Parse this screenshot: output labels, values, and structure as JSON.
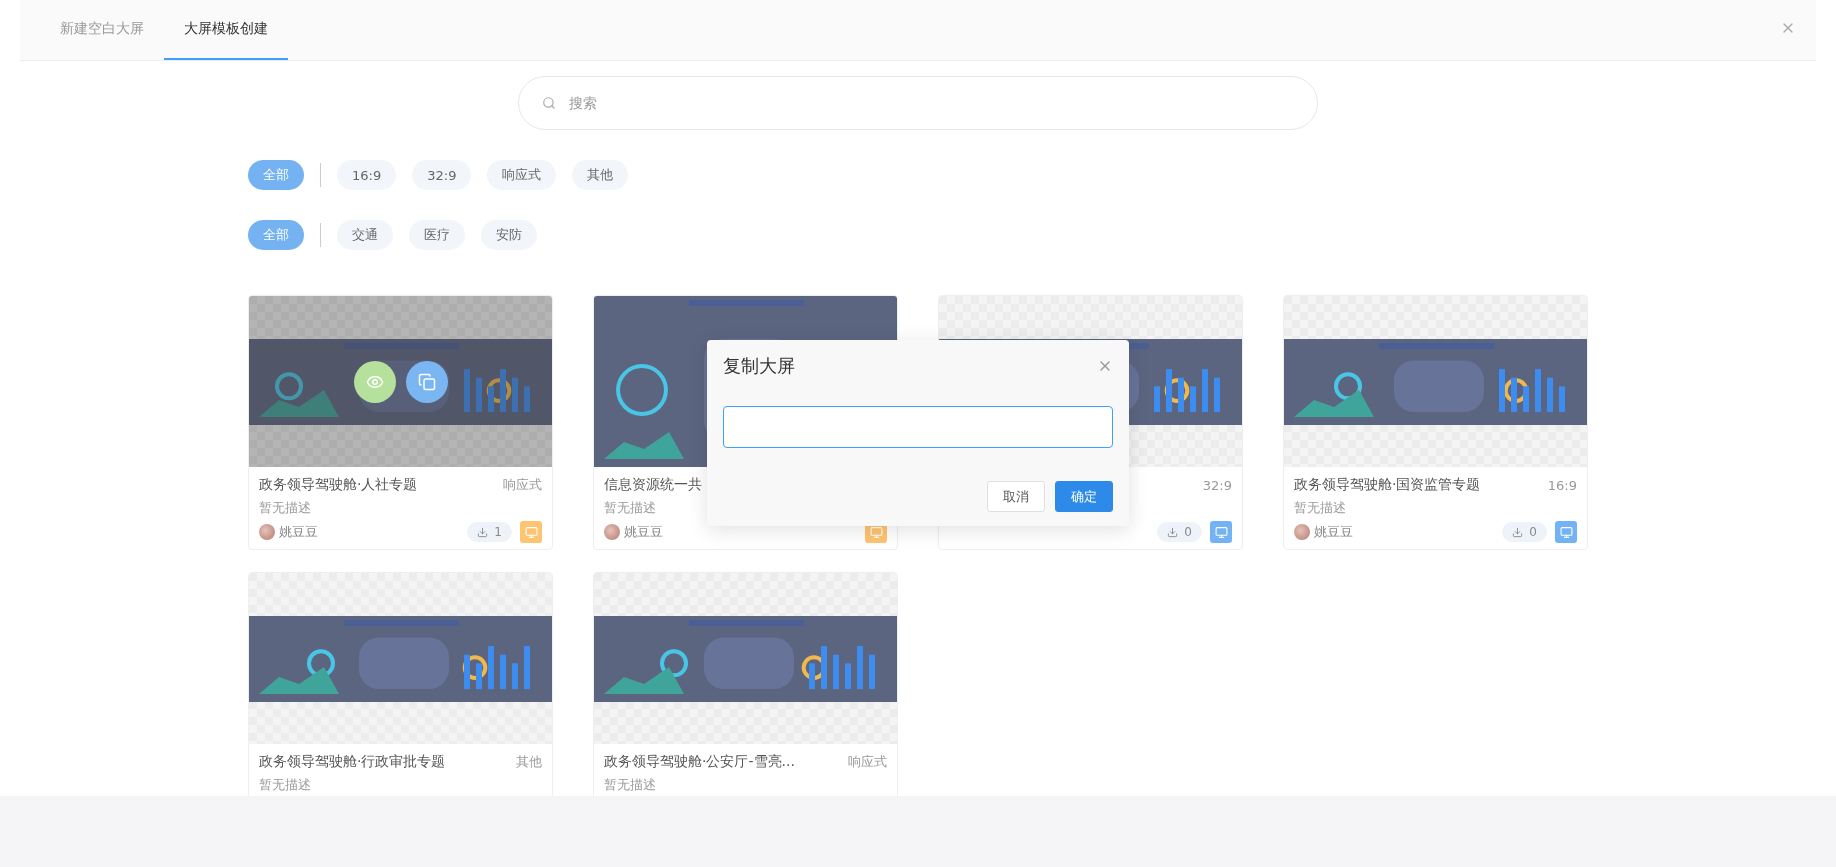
{
  "tabs": [
    {
      "label": "新建空白大屏",
      "selected": false
    },
    {
      "label": "大屏模板创建",
      "selected": true
    }
  ],
  "search": {
    "placeholder": "搜索"
  },
  "filter_rows": [
    {
      "chips": [
        {
          "label": "全部",
          "selected": true
        },
        {
          "label": "16:9",
          "selected": false
        },
        {
          "label": "32:9",
          "selected": false
        },
        {
          "label": "响应式",
          "selected": false
        },
        {
          "label": "其他",
          "selected": false
        }
      ]
    },
    {
      "chips": [
        {
          "label": "全部",
          "selected": true
        },
        {
          "label": "交通",
          "selected": false
        },
        {
          "label": "医疗",
          "selected": false
        },
        {
          "label": "安防",
          "selected": false
        }
      ]
    }
  ],
  "cards": [
    {
      "title": "政务领导驾驶舱·人社专题",
      "type": "响应式",
      "description": "暂无描述",
      "author": "姚豆豆",
      "downloads": "1",
      "color": "#ffc470",
      "hovered": true
    },
    {
      "title": "信息资源统一共",
      "description": "暂无描述",
      "author": "姚豆豆",
      "color": "#ffc470",
      "hovered": false
    },
    {
      "type": "32:9",
      "downloads": "0",
      "color": "#73b3f3",
      "hovered": false
    },
    {
      "title": "政务领导驾驶舱·国资监管专题",
      "type": "16:9",
      "description": "暂无描述",
      "author": "姚豆豆",
      "downloads": "0",
      "color": "#73b3f3",
      "hovered": false
    },
    {
      "title": "政务领导驾驶舱·行政审批专题",
      "type": "其他",
      "description": "暂无描述",
      "hovered": false
    },
    {
      "title": "政务领导驾驶舱·公安厅-雪亮...",
      "type": "响应式",
      "description": "暂无描述",
      "hovered": false
    }
  ],
  "dialog": {
    "title": "复制大屏",
    "input": {
      "focused": true
    },
    "buttons": [
      {
        "label": "取消",
        "kind": "secondary"
      },
      {
        "label": "确定",
        "kind": "primary"
      }
    ]
  }
}
